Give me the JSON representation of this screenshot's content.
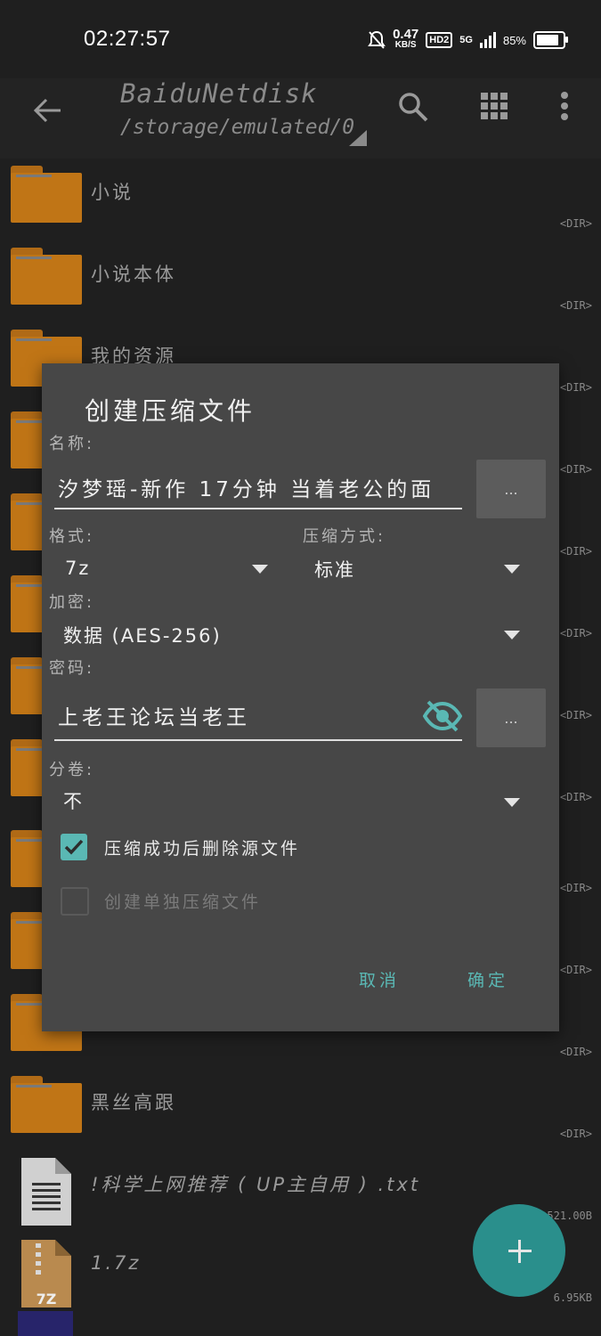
{
  "status": {
    "time": "02:27:57",
    "speed": "0.47",
    "speed_unit": "KB/S",
    "hd": "HD2",
    "net": "5G",
    "battery_pct": "85%",
    "battery_level": 0.85
  },
  "appbar": {
    "title": "BaiduNetdisk",
    "path": "/storage/emulated/0"
  },
  "files": [
    {
      "name": "小说",
      "meta": "<DIR>"
    },
    {
      "name": "小说本体",
      "meta": "<DIR>"
    },
    {
      "name": "我的资源",
      "meta": "<DIR>"
    },
    {
      "name": "",
      "meta": "<DIR>"
    },
    {
      "name": "",
      "meta": "<DIR>"
    },
    {
      "name": "",
      "meta": "<DIR>"
    },
    {
      "name": "",
      "meta": "<DIR>"
    },
    {
      "name": "",
      "meta": "<DIR>"
    },
    {
      "name": "",
      "meta": "<DIR>"
    },
    {
      "name": "",
      "meta": "<DIR>"
    },
    {
      "name": "",
      "meta": "<DIR>"
    },
    {
      "name": "黑丝高跟",
      "meta": "<DIR>"
    },
    {
      "name": "!科学上网推荐 ( UP主自用 ) .txt",
      "meta": "521.00B"
    },
    {
      "name": "1.7z",
      "meta": "6.95KB"
    }
  ],
  "file_icons": {
    "txt": "text-file-icon",
    "archive": "7z-archive-icon",
    "archive_label": "7Z"
  },
  "dialog": {
    "title": "创建压缩文件",
    "name_label": "名称:",
    "name_value": "汐梦瑶-新作 17分钟 当着老公的面",
    "browse_label": "...",
    "format_label": "格式:",
    "format_value": "7z",
    "method_label": "压缩方式:",
    "method_value": "标准",
    "encrypt_label": "加密:",
    "encrypt_value": "数据 (AES-256)",
    "password_label": "密码:",
    "password_value": "上老王论坛当老王",
    "password_btn": "...",
    "split_label": "分卷:",
    "split_value": "不",
    "delete_source_label": "压缩成功后删除源文件",
    "delete_source_checked": true,
    "separate_label": "创建单独压缩文件",
    "separate_checked": false,
    "cancel": "取消",
    "ok": "确定"
  },
  "colors": {
    "accent": "#5ab8b4",
    "folder": "#c07516",
    "fab": "#2a8f8c"
  }
}
